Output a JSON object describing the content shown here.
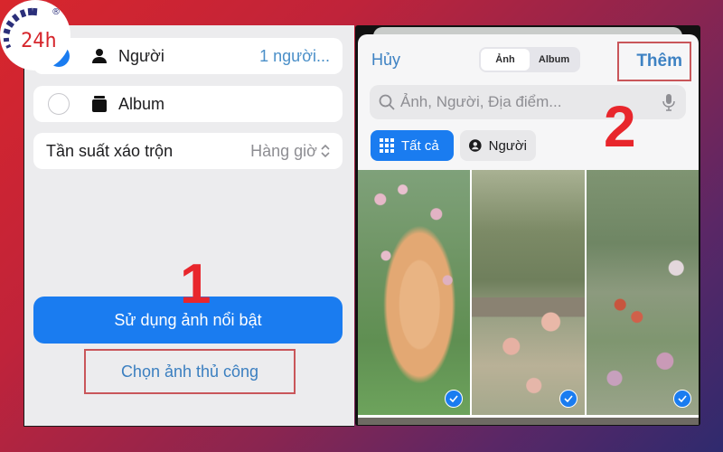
{
  "logo": {
    "text": "24h",
    "registered": "®"
  },
  "left": {
    "rows": [
      {
        "id": "people",
        "label": "Người",
        "value": "1 người...",
        "selected": true,
        "icon": "person-icon"
      },
      {
        "id": "album",
        "label": "Album",
        "value": "",
        "selected": false,
        "icon": "album-stack-icon"
      }
    ],
    "shuffle": {
      "label": "Tần suất xáo trộn",
      "value": "Hàng giờ",
      "icon": "chevron-updown-icon"
    },
    "primary_button": "Sử dụng ảnh nổi bật",
    "secondary_button": "Chọn ảnh thủ công",
    "step_marker": "1"
  },
  "right": {
    "cancel": "Hủy",
    "segments": [
      {
        "label": "Ảnh",
        "active": true
      },
      {
        "label": "Album",
        "active": false
      }
    ],
    "add": "Thêm",
    "search": {
      "placeholder": "Ảnh, Người, Địa điểm...",
      "value": ""
    },
    "chips": [
      {
        "label": "Tất cả",
        "active": true,
        "icon": "grid-icon"
      },
      {
        "label": "Người",
        "active": false,
        "icon": "person-circle-icon"
      }
    ],
    "step_marker": "2",
    "photos": [
      {
        "subject": "orange cat among roses",
        "selected": true
      },
      {
        "subject": "garden bench with roses",
        "selected": true
      },
      {
        "subject": "flower garden",
        "selected": true
      }
    ]
  },
  "colors": {
    "accent": "#1a7cf0",
    "link": "#3e82c3",
    "highlight": "#c9565a",
    "step": "#e8262c"
  }
}
